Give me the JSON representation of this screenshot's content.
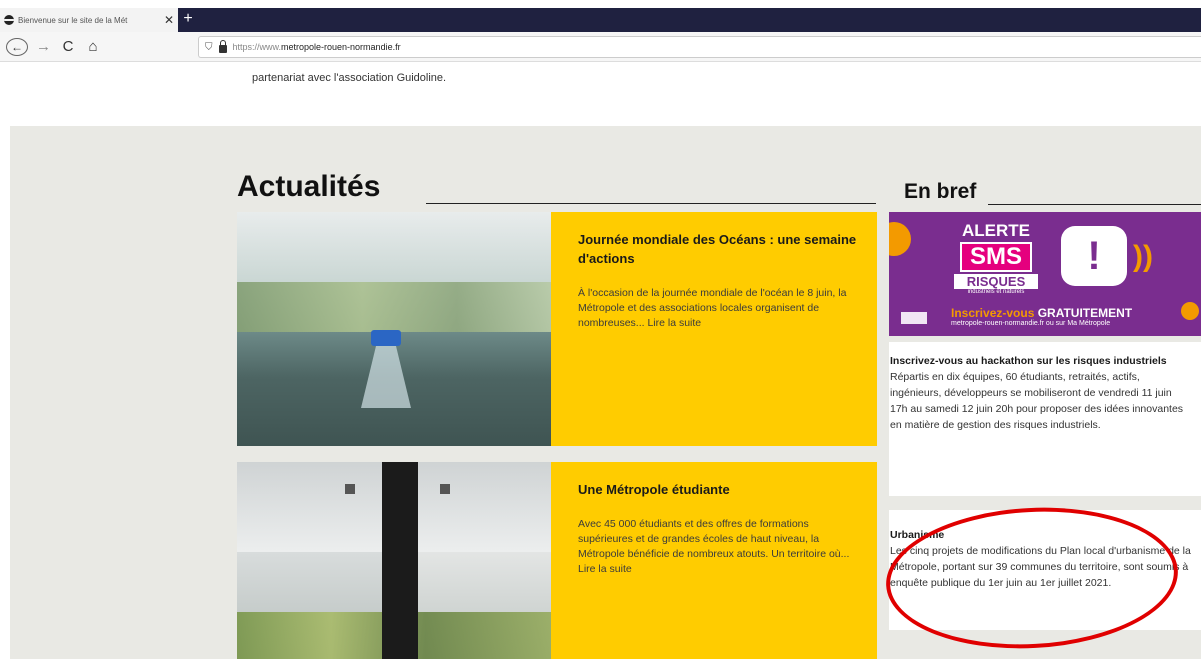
{
  "browser": {
    "tab_title": "Bienvenue sur le site de la Mét",
    "tab_close": "✕",
    "new_tab": "+",
    "nav": {
      "back": "←",
      "forward": "→",
      "reload": "C",
      "home": "⌂"
    },
    "url_prefix": "https://www.",
    "url_domain": "metropole-rouen-normandie.fr",
    "url_shield": "⛉"
  },
  "page": {
    "intro_text": "partenariat avec l'association Guidoline.",
    "actualites_title": "Actualités",
    "enbref_title": "En bref",
    "news": [
      {
        "title": "Journée mondiale des Océans : une semaine d'actions",
        "text": "À l'occasion de la journée mondiale de l'océan le 8 juin, la Métropole et des associations locales organisent de nombreuses... Lire la suite"
      },
      {
        "title": "Une Métropole étudiante",
        "text": "Avec 45 000 étudiants et des offres de formations supérieures et de grandes écoles de haut niveau, la Métropole bénéficie de nombreux atouts. Un territoire où... Lire la suite"
      }
    ],
    "sms_banner": {
      "alerte": "ALERTE",
      "sms": "SMS",
      "risques": "RISQUES",
      "risques_sub": "industriels et naturels",
      "bubble": "!",
      "waves": "))",
      "cta_prefix": "Inscrivez-vous ",
      "cta_bold": "GRATUITEMENT",
      "url": "metropole-rouen-normandie.fr ou sur Ma Métropole"
    },
    "briefs": [
      {
        "title": "Inscrivez-vous au hackathon sur les risques industriels",
        "text": "Répartis en dix équipes, 60 étudiants, retraités, actifs, ingénieurs, développeurs se mobiliseront de vendredi 11 juin 17h au samedi 12 juin 20h pour proposer des idées innovantes en matière de gestion des risques industriels."
      },
      {
        "title": "Urbanisme",
        "text": "Les cinq projets de modifications du Plan local d'urbanisme de la Métropole, portant sur 39 communes du territoire, sont soumis à enquête publique du 1er juin au 1er juillet 2021."
      }
    ]
  },
  "colors": {
    "accent_yellow": "#ffcc00",
    "sms_purple": "#7a2d8f",
    "sms_orange": "#f39a00",
    "annotation_red": "#e00000"
  }
}
